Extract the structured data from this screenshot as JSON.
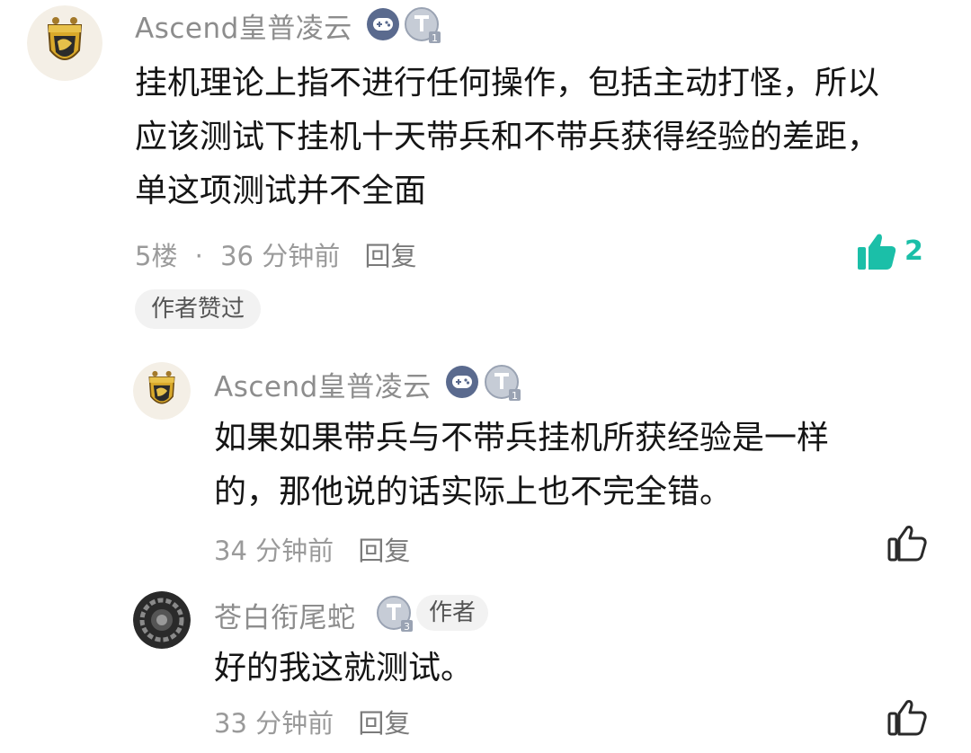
{
  "comment": {
    "username": "Ascend皇普凌云",
    "level_badge": "1",
    "text_lines": [
      "挂机理论上指不进行任何操作，包括主动打怪，所以",
      "应该测试下挂机十天带兵和不带兵获得经验的差距，",
      "单这项测试并不全面"
    ],
    "floor": "5楼",
    "separator": "·",
    "time": "36 分钟前",
    "reply_label": "回复",
    "like_count": "2",
    "liked_by_author_label": "作者赞过"
  },
  "replies": [
    {
      "username": "Ascend皇普凌云",
      "level_badge": "1",
      "text_lines": [
        "如果如果带兵与不带兵挂机所获经验是一样",
        "的，那他说的话实际上也不完全错。"
      ],
      "time": "34 分钟前",
      "reply_label": "回复"
    },
    {
      "username": "苍白衔尾蛇",
      "level_badge": "3",
      "author_tag": "作者",
      "text_lines": [
        "好的我这就测试。"
      ],
      "time": "33 分钟前",
      "reply_label": "回复"
    }
  ],
  "colors": {
    "accent_liked": "#1bbfa8",
    "username": "#8d8d8d",
    "meta": "#9a9a9a",
    "game_badge": "#5a6a8e"
  },
  "icons": [
    "hufflepuff-crest-avatar",
    "gamepad-icon",
    "level-t-icon",
    "thumbs-up-filled-icon",
    "thumbs-up-outline-icon",
    "ouroboros-avatar"
  ]
}
